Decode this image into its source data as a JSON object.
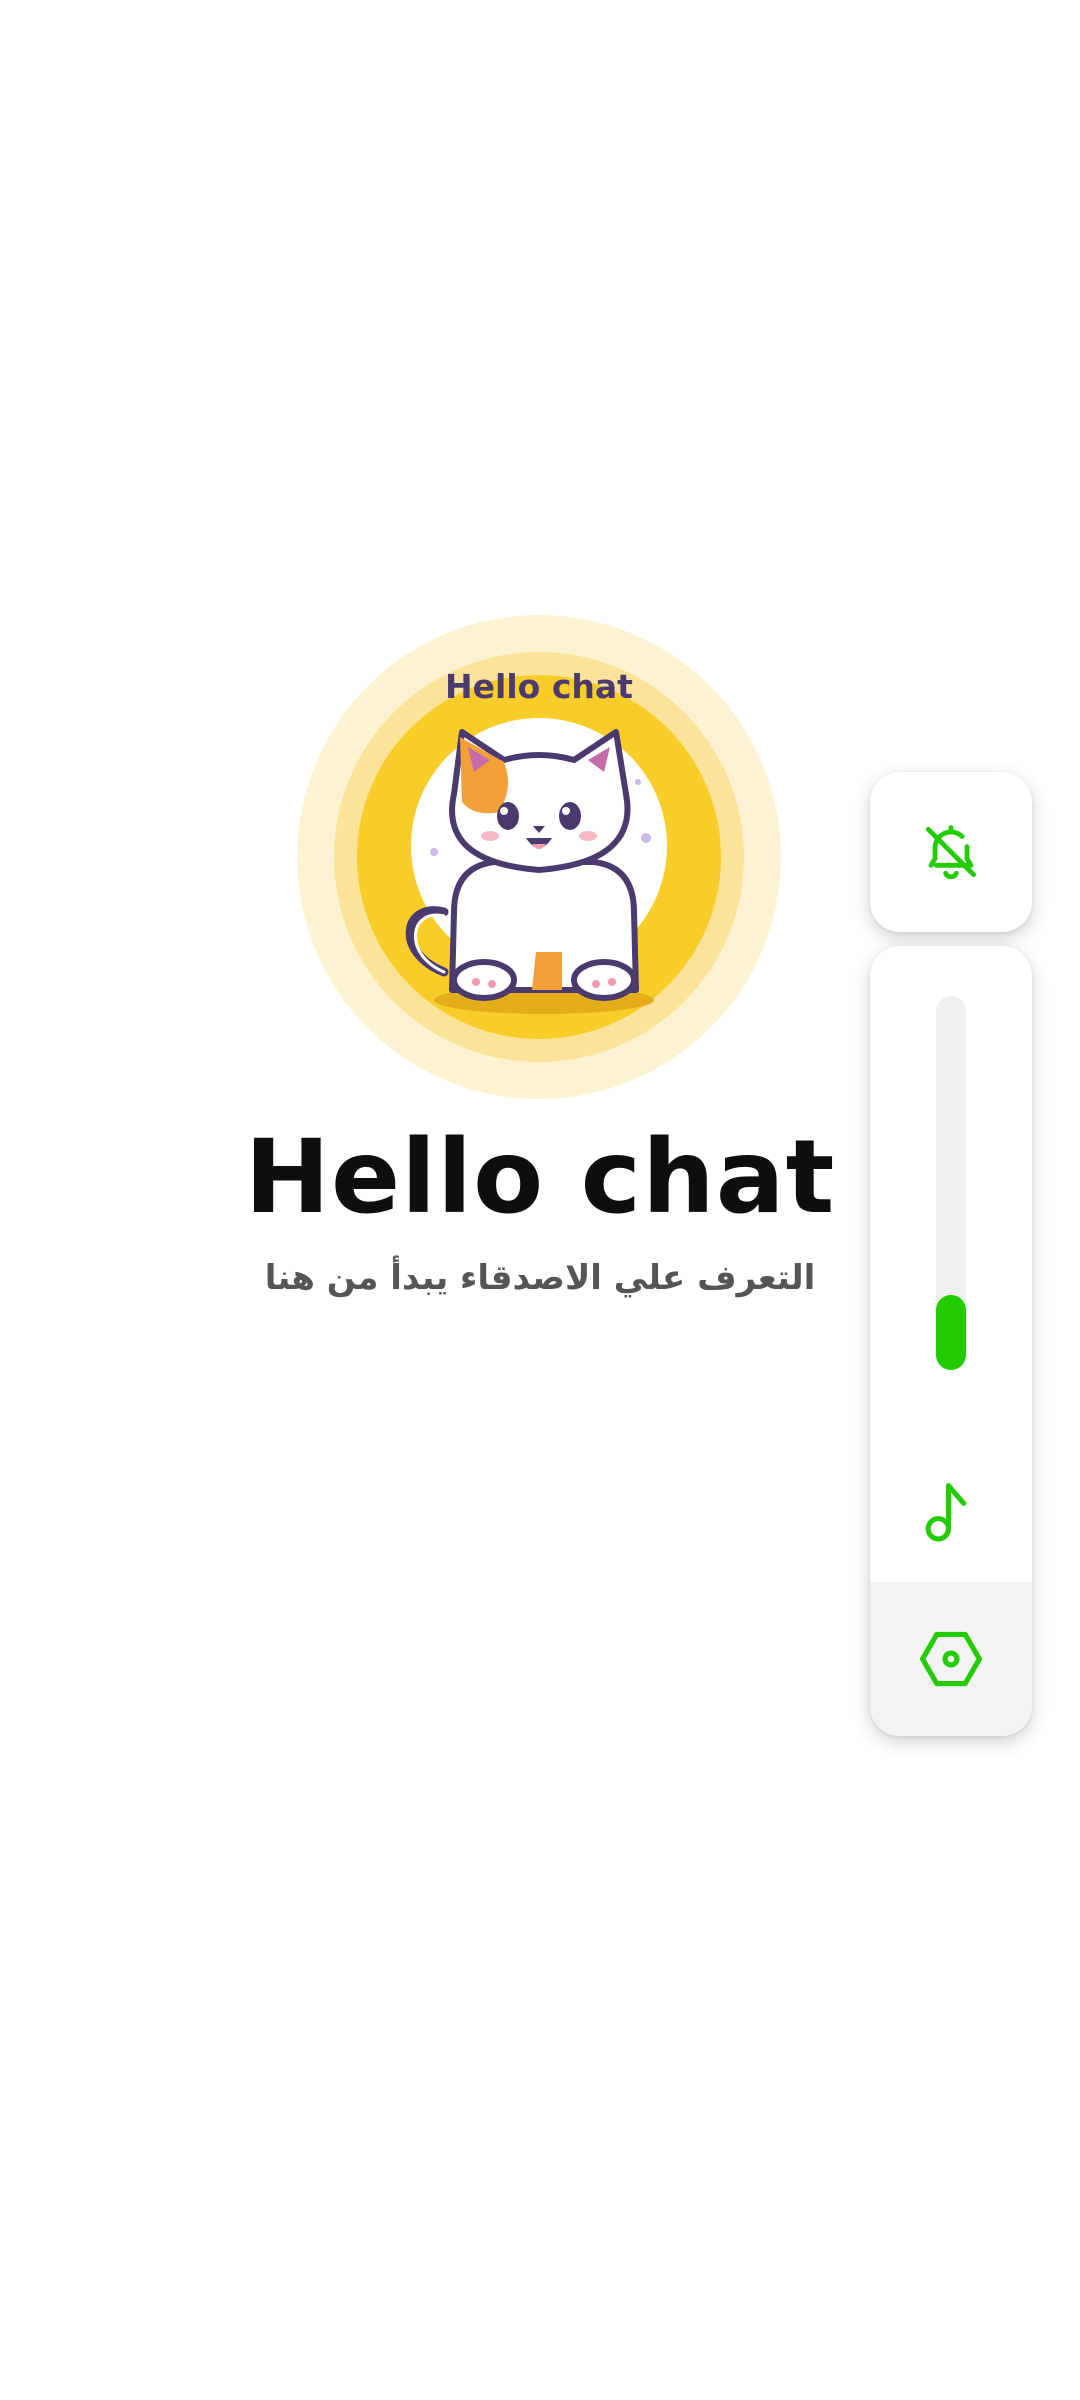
{
  "logo": {
    "badge_text": "Hello chat",
    "colors": {
      "outer_glow": "#fdf3d2",
      "ring": "#fbe39a",
      "disc": "#f8cd2a",
      "inner": "#ffffff",
      "cat_outline": "#4b3a6e",
      "cat_patch": "#f2a03a"
    }
  },
  "app": {
    "title": "Hello chat",
    "subtitle": "التعرف علي الاصدقاء يبدأ من هنا"
  },
  "volume_panel": {
    "ringer_icon": "bell-off-icon",
    "level": 0.2,
    "stream_icon": "music-note-icon",
    "settings_icon": "hexagon-settings-icon",
    "accent_color": "#22cc00"
  }
}
